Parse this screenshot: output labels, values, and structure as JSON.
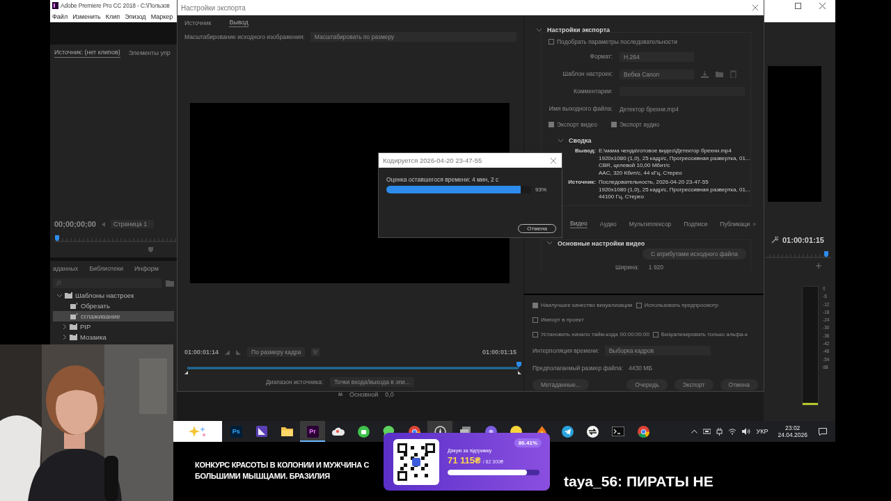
{
  "premiere": {
    "title": "Adobe Premiere Pro CC 2018 - C:\\Пользов",
    "menu": [
      "Файл",
      "Изменить",
      "Клип",
      "Эпизод",
      "Маркер"
    ],
    "source_panel": {
      "tabs": [
        {
          "label": "Источник: (нет клипов)",
          "selected": true
        },
        {
          "label": "Элементы упр",
          "selected": false
        }
      ],
      "timecode": "00;00;00;00",
      "page": "Страница 1"
    },
    "project_panel": {
      "tabs": [
        {
          "label": "аданных",
          "selected": false
        },
        {
          "label": "Библиотеки",
          "selected": false
        },
        {
          "label": "Информ",
          "selected": false
        }
      ],
      "tree": [
        {
          "label": "Шаблоны настроек",
          "kind": "folder",
          "expanded": true,
          "selected": false,
          "children": [
            {
              "label": "Обрезать",
              "kind": "preset",
              "selected": false
            },
            {
              "label": "сглаживание",
              "kind": "preset",
              "selected": true
            },
            {
              "label": "PIP",
              "kind": "folder",
              "expanded": false,
              "selected": false
            },
            {
              "label": "Мозаика",
              "kind": "folder",
              "expanded": false,
              "selected": false
            }
          ]
        }
      ]
    },
    "program_panel": {
      "timecode": "01:00:01:15"
    },
    "audio_meter": {
      "scale": [
        "0",
        "-6",
        "-12",
        "-18",
        "-24",
        "-30",
        "-36",
        "-42",
        "-48",
        "-54",
        "dB"
      ]
    },
    "timeline": {
      "track": "Основной",
      "value": "0,0"
    }
  },
  "export_dialog": {
    "title": "Настройки экспорта",
    "tabs": [
      {
        "label": "Источник",
        "selected": false
      },
      {
        "label": "Вывод",
        "selected": true
      }
    ],
    "scaling": {
      "label": "Масштабирование исходного изображения:",
      "value": "Масштабировать по размеру"
    },
    "time_in": "01:00:01:14",
    "fit": "По размеру кадра",
    "time_out": "01:00:01:15",
    "playhead": {
      "level": 1
    },
    "source_range": {
      "label": "Диапазон источника:",
      "value": "Точки входа/выхода в эпи..."
    },
    "settings": {
      "heading": "Настройки экспорта",
      "match_sequence": {
        "label": "Подобрать параметры последовательности",
        "checked": false
      },
      "fields": [
        {
          "label": "Формат:",
          "value": "H.264",
          "kind": "dropdown"
        },
        {
          "label": "Шаблон настроек:",
          "value": "Вебка Canon",
          "kind": "preset"
        },
        {
          "label": "Комментарии:",
          "kind": "input"
        },
        {
          "label": "Имя выходного файла:",
          "value": "Детектор брехни.mp4",
          "kind": "link"
        }
      ],
      "exports": [
        {
          "label": "Экспорт видео",
          "checked": true
        },
        {
          "label": "Экспорт аудио",
          "checked": true
        }
      ],
      "summary": {
        "heading": "Сводка",
        "groups": [
          {
            "label": "Вывод:",
            "lines": [
              "E:\\мама ченда\\готовое видео\\Детектор брехни.mp4",
              "1920x1080 (1,0), 25 кадр/с, Прогрессивная развертка, 01...",
              "CBR, целевой 10,00 Мбит/с",
              "AAC, 320 Кбит/с, 44 кГц, Стерео"
            ]
          },
          {
            "label": "Источник:",
            "lines": [
              "Последовательность, 2026-04-20 23-47-55",
              "1920x1080 (1,0), 25 кадр/с, Прогрессивная развертка, 01...",
              "44100 Гц, Стерео"
            ]
          }
        ]
      }
    },
    "tabs2": [
      {
        "label": "Видео",
        "selected": true
      },
      {
        "label": "Аудио",
        "selected": false
      },
      {
        "label": "Мультиплексор",
        "selected": false
      },
      {
        "label": "Подписи",
        "selected": false
      },
      {
        "label": "Публикаци",
        "selected": false
      }
    ],
    "tabs_more": "»",
    "video": {
      "heading": "Основные настройки видео",
      "match_button": "С атрибутами исходного файла",
      "width_label": "Ширина:",
      "width": "1 920"
    },
    "option_rows": [
      [
        {
          "label": "Наилучшее качество визуализации",
          "checked": true
        },
        {
          "label": "Использовать предпросмотр",
          "checked": false
        }
      ],
      [
        {
          "label": "Импорт в проект",
          "checked": false
        }
      ],
      [
        {
          "label": "Установить начало тайм-кода",
          "checked": false,
          "value": "00:00:00:00"
        },
        {
          "label": "Визуализировать только альфа-к",
          "checked": false
        }
      ]
    ],
    "interpolation": {
      "label": "Интерполяция времени:",
      "value": "Выборка кадров"
    },
    "file_size": {
      "label": "Предполагаемый размер файла:",
      "value": "4430 МБ"
    },
    "buttons": [
      "Метаданные...",
      "Очередь",
      "Экспорт",
      "Отмена"
    ]
  },
  "progress_dialog": {
    "title": "Кодируется 2026-04-20 23-47-55",
    "estimate": "Оценка оставшегося времени: 4 мин, 2 с",
    "level": 0.93,
    "percent": "93%",
    "cancel": "Отмена"
  },
  "taskbar": {
    "apps": [
      {
        "kind": "sparkle",
        "selected": false
      },
      {
        "kind": "ps",
        "label": "Ps",
        "selected": false
      },
      {
        "kind": "triangle",
        "selected": false
      },
      {
        "kind": "folder",
        "selected": false
      },
      {
        "kind": "pr",
        "label": "Pr",
        "selected": true
      },
      {
        "kind": "cloud",
        "selected": false
      },
      {
        "kind": "circle",
        "selected": false
      },
      {
        "kind": "chat",
        "selected": false
      },
      {
        "kind": "browser",
        "selected": false
      },
      {
        "kind": "compass",
        "selected": true
      },
      {
        "kind": "files",
        "selected": false
      },
      {
        "kind": "disc",
        "selected": false
      },
      {
        "kind": "smiley",
        "selected": false
      },
      {
        "kind": "flame",
        "selected": false
      },
      {
        "kind": "plane",
        "selected": false
      },
      {
        "kind": "arrows",
        "selected": false
      },
      {
        "kind": "terminal",
        "selected": false
      },
      {
        "kind": "browser",
        "selected": false
      }
    ],
    "language": "УКР",
    "time": "23:02",
    "date": "24.04.2026"
  },
  "stream": {
    "headline_lines": [
      "КОНКУРС КРАСОТЫ В КОЛОНИИ И МУЖЧИНА С",
      "БОЛЬШИМИ МЫШЦАМИ. БРАЗИЛИЯ"
    ],
    "donation": {
      "title": "Дякую за підтримку",
      "raised": "71 115₴",
      "goal": "/ 82 300₴",
      "percent": "86.41%",
      "level": 0.8641
    },
    "chat": "taya_56: ПИРАТЫ НЕ"
  }
}
